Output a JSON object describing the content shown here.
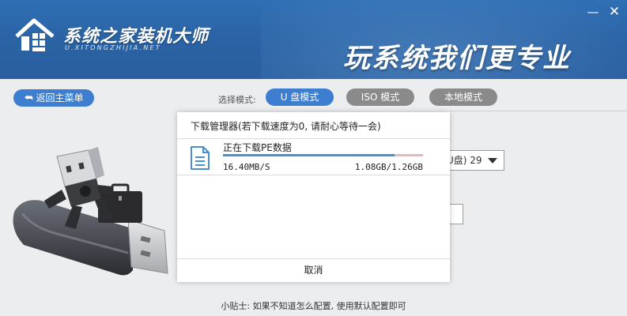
{
  "header": {
    "brand_name": "系统之家装机大师",
    "brand_url": "U.XITONGZHIJIA.NET",
    "slogan": "玩系统我们更专业",
    "minimize_icon": "minimize-icon",
    "close_icon": "close-icon"
  },
  "toolbar": {
    "back_label": "返回主菜单",
    "mode_label": "选择模式:",
    "modes": [
      "U 盘模式",
      "ISO 模式",
      "本地模式"
    ],
    "active_mode": "U 盘模式"
  },
  "right_panel": {
    "combo_value": "U盘) 29"
  },
  "tip": "小贴士: 如果不知道怎么配置, 使用默认配置即可",
  "download_dialog": {
    "title": "下载管理器(若下载速度为0, 请耐心等待一会)",
    "item_name": "正在下载PE数据",
    "speed": "16.40MB/S",
    "size": "1.08GB/1.26GB",
    "progress_fraction": 0.857,
    "cancel_label": "取消",
    "file_icon": "document-icon"
  },
  "colors": {
    "header_blue": "#2c66a8",
    "accent_blue": "#3d7ed0",
    "inactive_gray": "#8a8a8a",
    "progress_fill": "#4a8fd0",
    "progress_track": "#e3b9b9"
  }
}
